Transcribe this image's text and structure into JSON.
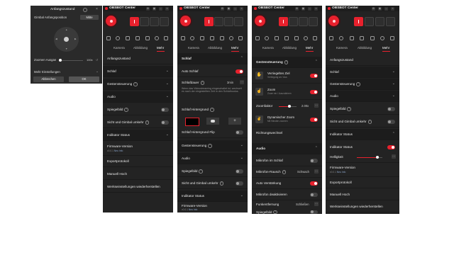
{
  "popup": {
    "title": "Anfangszustand",
    "gimbal_label": "Gimbal Anfangsposition",
    "center_button": "Mitte",
    "zoom_label": "Zoomen Ausgan",
    "zoom_value": "100x",
    "more_settings": "Mehr Einstellungen",
    "cancel": "Abbrechen",
    "ok": "OK"
  },
  "app_title": "OBSBOT Center",
  "tabs": [
    "Kamera",
    "Abbildung",
    "Mehr"
  ],
  "panel1": {
    "anfangszustand": "Anfangszustand",
    "schlaf": "Schlaf",
    "gestensteuerung": "Gestensteuerung",
    "audio": "Audio",
    "spiegelbild": "Spiegelbild",
    "sicht_gimbal": "Sicht und Gimbal umkehr",
    "indikator_status": "Indikator Status",
    "firmware": "Firmware-Version",
    "firmware_sub": "v0.0.1",
    "neu_info": "Neu Info",
    "exportprotokoll": "Exportprotokoll",
    "manuell": "Manuell Hoch",
    "werkseinstellungen": "Werkseinstellungen wiederherstellen"
  },
  "panel2": {
    "schlaf": "Schlaf",
    "auto_schlaf": "Auto Schlaf",
    "schlafdauer": "Schlafdauer",
    "schlafdauer_val": "3min",
    "desc": "Wenn das Videostreaming eingeschaltet ist, wechselt es nach der eingestellten Zeit in den Schlafmodus.",
    "hintergrund": "Schlaf Hintergrund",
    "hintergrund_flip": "Schlaf Hintergrund Flip",
    "gestensteuerung": "Gestensteuerung",
    "audio": "Audio",
    "spiegelbild": "Spiegelbild",
    "sicht_gimbal": "Sicht und Gimbal umkehr",
    "indikator_status": "Indikator Status",
    "firmware": "Firmware-Version",
    "firmware_sub": "v0.0.1",
    "neu_info": "Neu Info"
  },
  "panel3": {
    "gestensteuerung": "Gestensteuerung",
    "verriegeltes_ziel": "Verriegeltes Ziel",
    "verriegeltes_sub": "Verfolgung an / Aus",
    "zoom": "Zoom",
    "zoom_sub": "Zoom ein / Auszufahren",
    "zoomfaktor": "Zoomfaktor",
    "zoomfaktor_val": "2.00x",
    "dyn_zoom": "Dynamischer Zoom",
    "dyn_zoom_sub": "Mit Händen zoomen",
    "richtungswechsel": "Richtungswechsel",
    "audio": "Audio",
    "mikrofon_schlaf": "Mikrofon im Schlaf",
    "mikrofon_rausch": "Mikrofon-Rausch",
    "mikrofon_rausch_val": "Schwach",
    "auto_verst": "Auto Verstärkung",
    "mikrofon_deakt": "Mikrofon deaktivieren",
    "funkentfernung": "Funkentfernung",
    "funkentfernung_val": "Schließen",
    "spiegelbild": "Spiegelbild"
  },
  "panel4": {
    "anfangszustand": "Anfangszustand",
    "schlaf": "Schlaf",
    "gestensteuerung": "Gestensteuerung",
    "audio": "Audio",
    "spiegelbild": "Spiegelbild",
    "sicht_gimbal": "Sicht und Gimbal umkehr",
    "indikator_status_hdr": "Indikator Status",
    "indikator_status": "Indikator Status",
    "helligkeit": "Helligkeit",
    "firmware": "Firmware-Version",
    "firmware_sub": "v0.0.1",
    "neu_info": "Neu Info",
    "exportprotokoll": "Exportprotokoll",
    "manuell": "Manuell Hoch",
    "werkseinstellungen": "Werkseinstellungen wiederherstellen"
  },
  "levels": {
    "popup_zoom": 0.06,
    "panel3_zoomfaktor": 0.6,
    "panel4_helligkeit": 0.8
  },
  "colors": {
    "accent": "#e8212d",
    "panel": "#232323",
    "row_dark": "#1c1c1c"
  }
}
